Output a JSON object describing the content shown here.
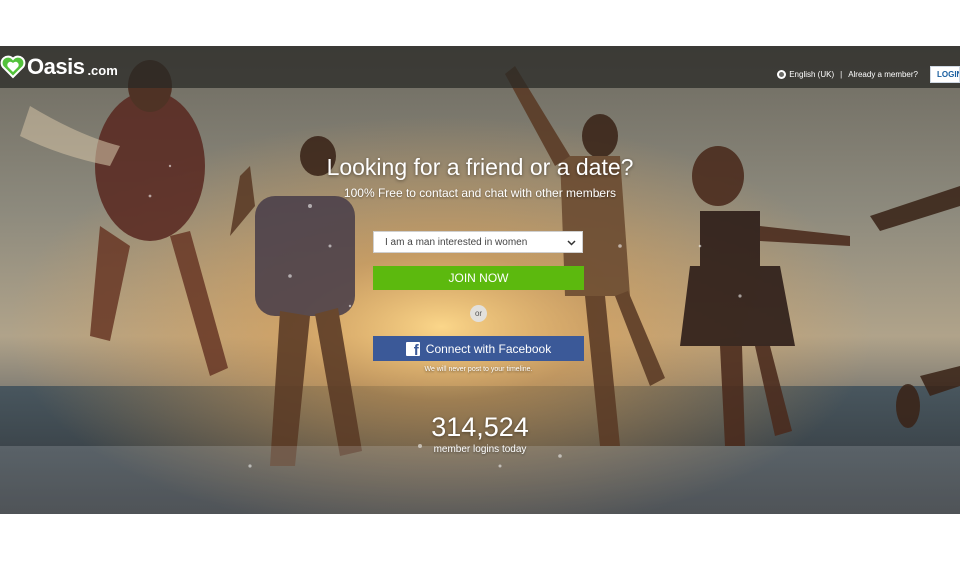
{
  "header": {
    "brand": "Oasis",
    "brand_domain": ".com",
    "language": "English (UK)",
    "separator": "|",
    "already_member": "Already a member?",
    "login_label": "LOGIN"
  },
  "hero": {
    "headline": "Looking for a friend or a date?",
    "subline": "100% Free to contact and chat with other members",
    "interest_select": {
      "selected": "I am a man interested in women"
    },
    "join_label": "JOIN NOW",
    "or_label": "or",
    "facebook_label": "Connect with Facebook",
    "facebook_note": "We will never post to your timeline.",
    "login_count": "314,524",
    "login_count_label": "member logins today"
  },
  "colors": {
    "join_green": "#5cb90e",
    "facebook_blue": "#3b5998",
    "logo_green": "#53c23b",
    "topbar": "#2a2a26"
  },
  "icons": {
    "logo": "heart-icon",
    "language": "globe-icon",
    "select": "chevron-down-icon",
    "facebook": "facebook-icon"
  }
}
